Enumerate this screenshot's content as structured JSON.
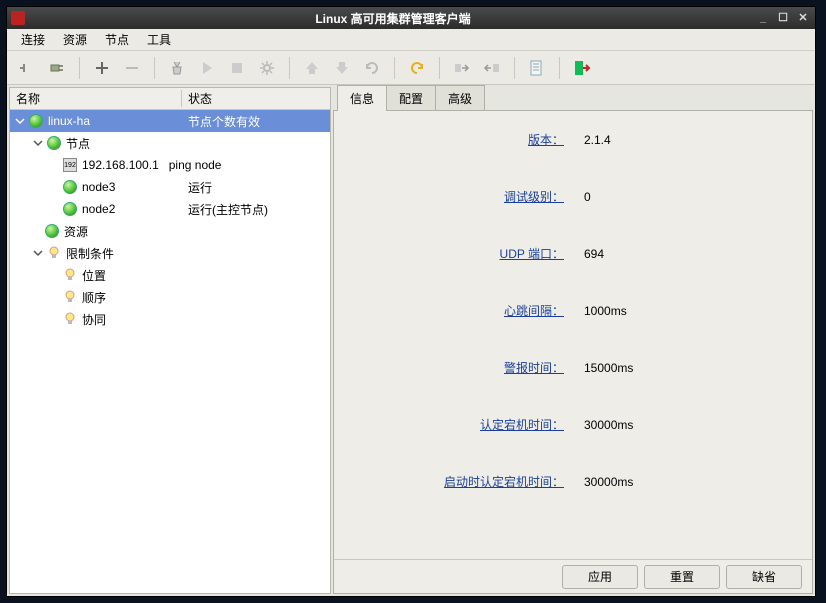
{
  "window": {
    "title": "Linux 高可用集群管理客户端"
  },
  "menubar": {
    "connect": "连接",
    "resource": "资源",
    "node": "节点",
    "tool": "工具"
  },
  "tree": {
    "header_name": "名称",
    "header_status": "状态",
    "root": {
      "label": "linux-ha",
      "status": "节点个数有效"
    },
    "nodes_label": "节点",
    "ip_node": {
      "label": "192.168.100.1",
      "status": "ping node"
    },
    "node3": {
      "label": "node3",
      "status": "运行"
    },
    "node2": {
      "label": "node2",
      "status": "运行(主控节点)"
    },
    "resources_label": "资源",
    "constraints_label": "限制条件",
    "location_label": "位置",
    "order_label": "顺序",
    "colocation_label": "协同"
  },
  "tabs": {
    "info": "信息",
    "config": "配置",
    "advanced": "高级"
  },
  "info": {
    "version": {
      "label": "版本：",
      "value": "2.1.4"
    },
    "debug_level": {
      "label": "调试级别：",
      "value": "0"
    },
    "udp_port": {
      "label": "UDP 端口：",
      "value": "694"
    },
    "heartbeat_interval": {
      "label": "心跳间隔：",
      "value": "1000ms"
    },
    "alarm_time": {
      "label": "警报时间：",
      "value": "15000ms"
    },
    "dead_time": {
      "label": "认定宕机时间：",
      "value": "30000ms"
    },
    "init_dead_time": {
      "label": "启动时认定宕机时间：",
      "value": "30000ms"
    }
  },
  "buttons": {
    "apply": "应用",
    "reset": "重置",
    "default": "缺省"
  }
}
